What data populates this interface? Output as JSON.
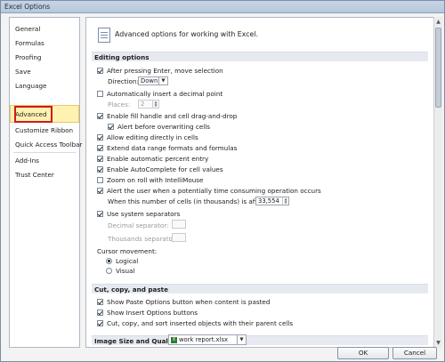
{
  "window": {
    "title": "Excel Options"
  },
  "sidebar": {
    "items": [
      {
        "label": "General"
      },
      {
        "label": "Formulas"
      },
      {
        "label": "Proofing"
      },
      {
        "label": "Save"
      },
      {
        "label": "Language"
      },
      {
        "label": "Advanced",
        "selected": true
      },
      {
        "label": "Customize Ribbon"
      },
      {
        "label": "Quick Access Toolbar"
      },
      {
        "label": "Add-Ins"
      },
      {
        "label": "Trust Center"
      }
    ]
  },
  "main": {
    "header": "Advanced options for working with Excel.",
    "icon": "options-page-icon",
    "sections": {
      "editing": {
        "title": "Editing options",
        "after_enter_move": {
          "label": "After pressing Enter, move selection",
          "checked": true
        },
        "direction_label": "Direction:",
        "direction_value": "Down",
        "auto_decimal": {
          "label": "Automatically insert a decimal point",
          "checked": false
        },
        "places_label": "Places:",
        "places_value": "2",
        "fill_handle": {
          "label": "Enable fill handle and cell drag-and-drop",
          "checked": true
        },
        "alert_overwrite": {
          "label": "Alert before overwriting cells",
          "checked": true
        },
        "edit_in_cells": {
          "label": "Allow editing directly in cells",
          "checked": true
        },
        "extend_formats": {
          "label": "Extend data range formats and formulas",
          "checked": true
        },
        "auto_percent": {
          "label": "Enable automatic percent entry",
          "checked": true
        },
        "autocomplete": {
          "label": "Enable AutoComplete for cell values",
          "checked": true
        },
        "zoom_roll": {
          "label": "Zoom on roll with IntelliMouse",
          "checked": false
        },
        "alert_slow": {
          "label": "Alert the user when a potentially time consuming operation occurs",
          "checked": true
        },
        "cells_affected_label": "When this number of cells (in thousands) is affected:",
        "cells_affected_value": "33,554",
        "system_separators": {
          "label": "Use system separators",
          "checked": true
        },
        "decimal_sep_label": "Decimal separator:",
        "thousands_sep_label": "Thousands separator:",
        "cursor_movement_label": "Cursor movement:",
        "cursor_logical": {
          "label": "Logical",
          "checked": true
        },
        "cursor_visual": {
          "label": "Visual",
          "checked": false
        }
      },
      "cut_copy_paste": {
        "title": "Cut, copy, and paste",
        "show_paste_options": {
          "label": "Show Paste Options button when content is pasted",
          "checked": true
        },
        "show_insert_options": {
          "label": "Show Insert Options buttons",
          "checked": true
        },
        "cut_copy_sort": {
          "label": "Cut, copy, and sort inserted objects with their parent cells",
          "checked": true
        }
      },
      "image_size": {
        "title": "Image Size and Quality",
        "workbook_value": "work report.xlsx"
      }
    }
  },
  "buttons": {
    "ok": "OK",
    "cancel": "Cancel"
  }
}
